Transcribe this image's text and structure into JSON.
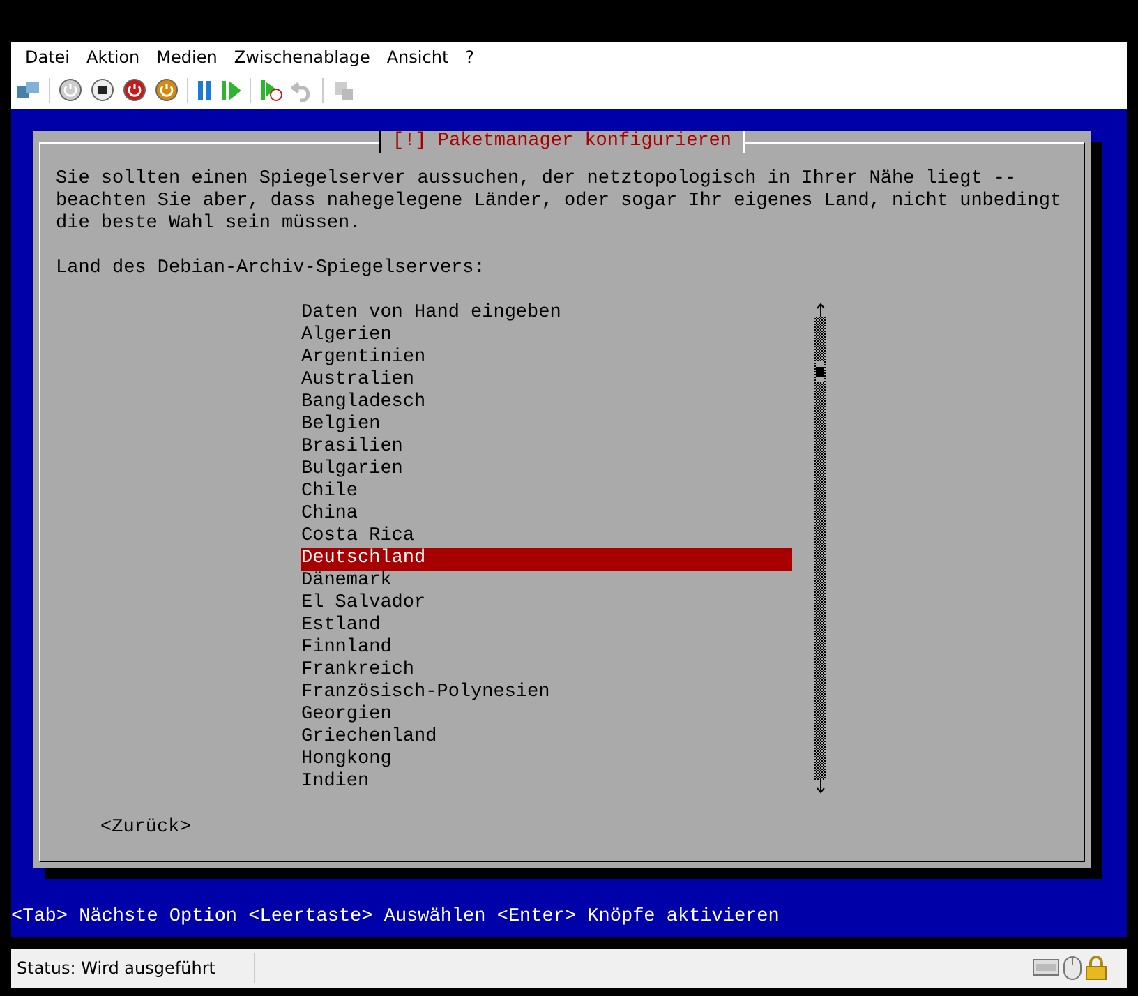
{
  "menu": [
    "Datei",
    "Aktion",
    "Medien",
    "Zwischenablage",
    "Ansicht",
    "?"
  ],
  "dialog": {
    "title": "[!] Paketmanager konfigurieren",
    "description": [
      "Sie sollten einen Spiegelserver aussuchen, der netztopologisch in Ihrer Nähe liegt --",
      "beachten Sie aber, dass nahegelegene Länder, oder sogar Ihr eigenes Land, nicht unbedingt",
      "die beste Wahl sein müssen."
    ],
    "prompt": "Land des Debian-Archiv-Spiegelservers:",
    "items": [
      {
        "label": "Daten von Hand eingeben",
        "selected": false
      },
      {
        "label": "Algerien",
        "selected": false
      },
      {
        "label": "Argentinien",
        "selected": false
      },
      {
        "label": "Australien",
        "selected": false
      },
      {
        "label": "Bangladesch",
        "selected": false
      },
      {
        "label": "Belgien",
        "selected": false
      },
      {
        "label": "Brasilien",
        "selected": false
      },
      {
        "label": "Bulgarien",
        "selected": false
      },
      {
        "label": "Chile",
        "selected": false
      },
      {
        "label": "China",
        "selected": false
      },
      {
        "label": "Costa Rica",
        "selected": false
      },
      {
        "label": "Deutschland",
        "selected": true
      },
      {
        "label": "Dänemark",
        "selected": false
      },
      {
        "label": "El Salvador",
        "selected": false
      },
      {
        "label": "Estland",
        "selected": false
      },
      {
        "label": "Finnland",
        "selected": false
      },
      {
        "label": "Frankreich",
        "selected": false
      },
      {
        "label": "Französisch-Polynesien",
        "selected": false
      },
      {
        "label": "Georgien",
        "selected": false
      },
      {
        "label": "Griechenland",
        "selected": false
      },
      {
        "label": "Hongkong",
        "selected": false
      },
      {
        "label": "Indien",
        "selected": false
      }
    ],
    "back_button": "<Zurück>"
  },
  "help_line": "<Tab> Nächste Option <Leertaste> Auswählen <Enter> Knöpfe aktivieren",
  "status_bar": "Status: Wird ausgeführt"
}
